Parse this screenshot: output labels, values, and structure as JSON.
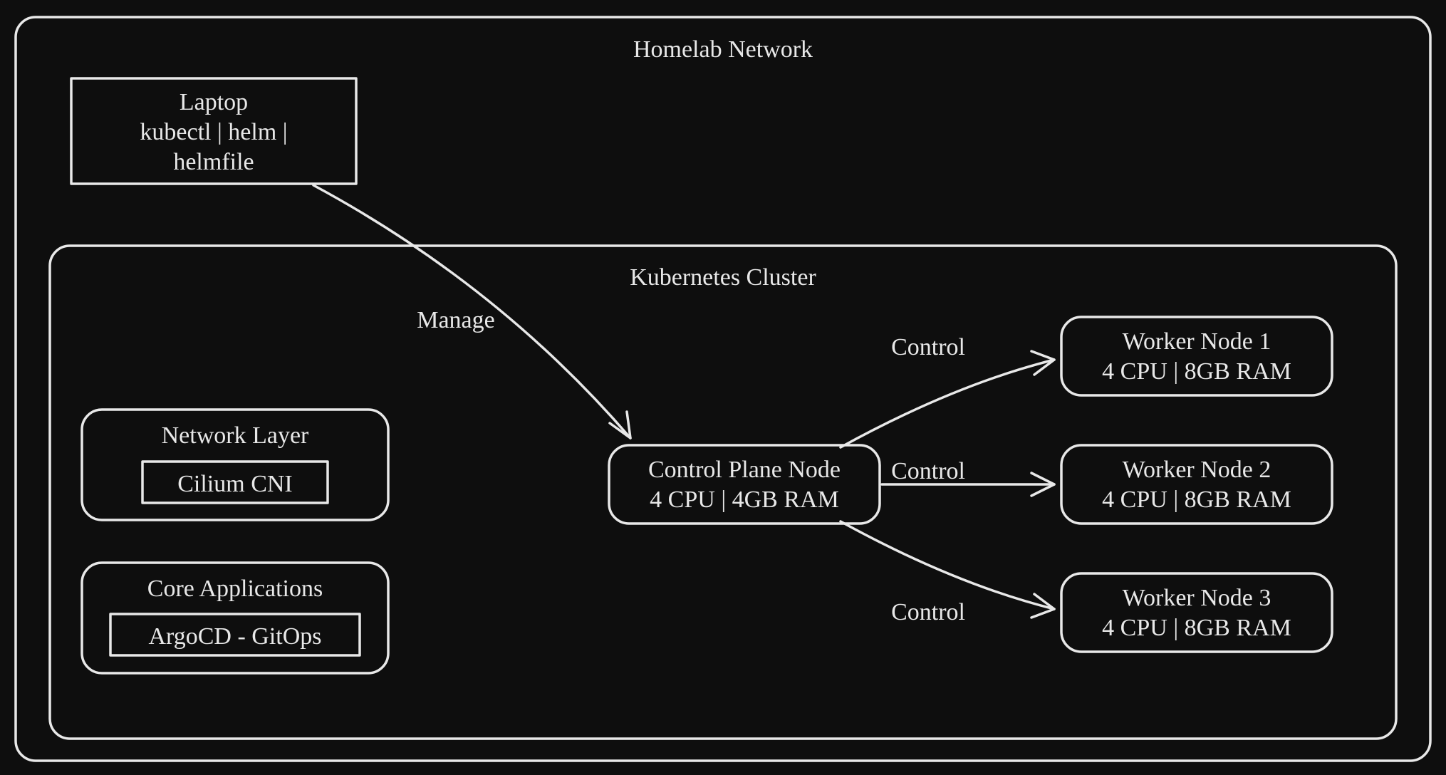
{
  "network": {
    "title": "Homelab Network"
  },
  "laptop": {
    "line1": "Laptop",
    "line2": "kubectl | helm |",
    "line3": "helmfile"
  },
  "cluster": {
    "title": "Kubernetes Cluster"
  },
  "netlayer": {
    "title": "Network Layer",
    "inner": "Cilium CNI"
  },
  "coreapps": {
    "title": "Core Applications",
    "inner": "ArgoCD - GitOps"
  },
  "control_plane": {
    "line1": "Control Plane Node",
    "line2": "4 CPU | 4GB RAM"
  },
  "workers": [
    {
      "line1": "Worker Node 1",
      "line2": "4 CPU | 8GB RAM"
    },
    {
      "line1": "Worker Node 2",
      "line2": "4 CPU | 8GB RAM"
    },
    {
      "line1": "Worker Node 3",
      "line2": "4 CPU | 8GB RAM"
    }
  ],
  "edges": {
    "manage": "Manage",
    "control": "Control"
  }
}
